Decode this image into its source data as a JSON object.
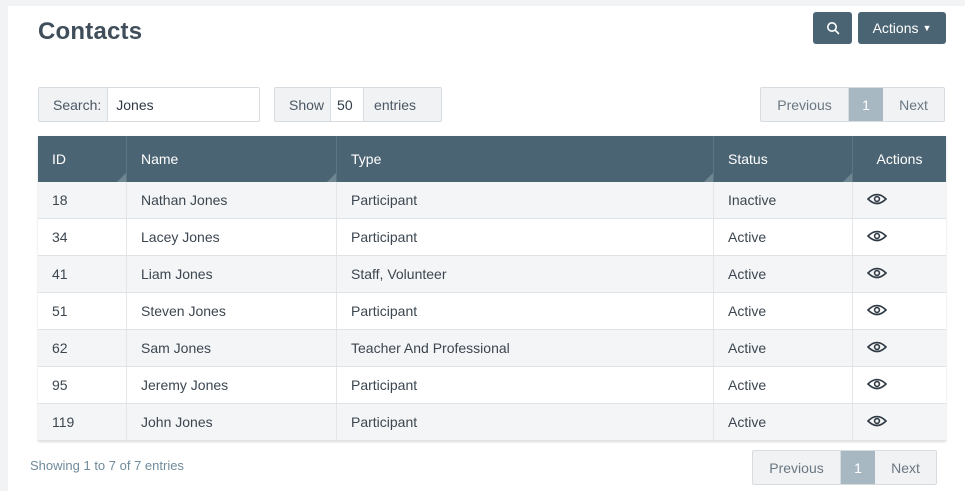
{
  "header": {
    "title": "Contacts",
    "search_icon": "search-icon",
    "actions_label": "Actions"
  },
  "toolbar": {
    "search_label": "Search:",
    "search_value": "Jones",
    "show_label": "Show",
    "show_value": "50",
    "entries_label": "entries"
  },
  "pagination": {
    "previous_label": "Previous",
    "current_page": "1",
    "next_label": "Next"
  },
  "table": {
    "columns": [
      "ID",
      "Name",
      "Type",
      "Status",
      "Actions"
    ],
    "rows": [
      {
        "id": "18",
        "name": "Nathan Jones",
        "type": "Participant",
        "status": "Inactive"
      },
      {
        "id": "34",
        "name": "Lacey Jones",
        "type": "Participant",
        "status": "Active"
      },
      {
        "id": "41",
        "name": "Liam Jones",
        "type": "Staff, Volunteer",
        "status": "Active"
      },
      {
        "id": "51",
        "name": "Steven Jones",
        "type": "Participant",
        "status": "Active"
      },
      {
        "id": "62",
        "name": "Sam Jones",
        "type": "Teacher And Professional",
        "status": "Active"
      },
      {
        "id": "95",
        "name": "Jeremy Jones",
        "type": "Participant",
        "status": "Active"
      },
      {
        "id": "119",
        "name": "John Jones",
        "type": "Participant",
        "status": "Active"
      }
    ],
    "row_action_icon": "eye-icon"
  },
  "footer": {
    "info": "Showing 1 to 7 of 7 entries"
  },
  "colors": {
    "header_bg": "#4b6473",
    "current_page_bg": "#a7b8c3",
    "info_text": "#6f8a9b"
  }
}
